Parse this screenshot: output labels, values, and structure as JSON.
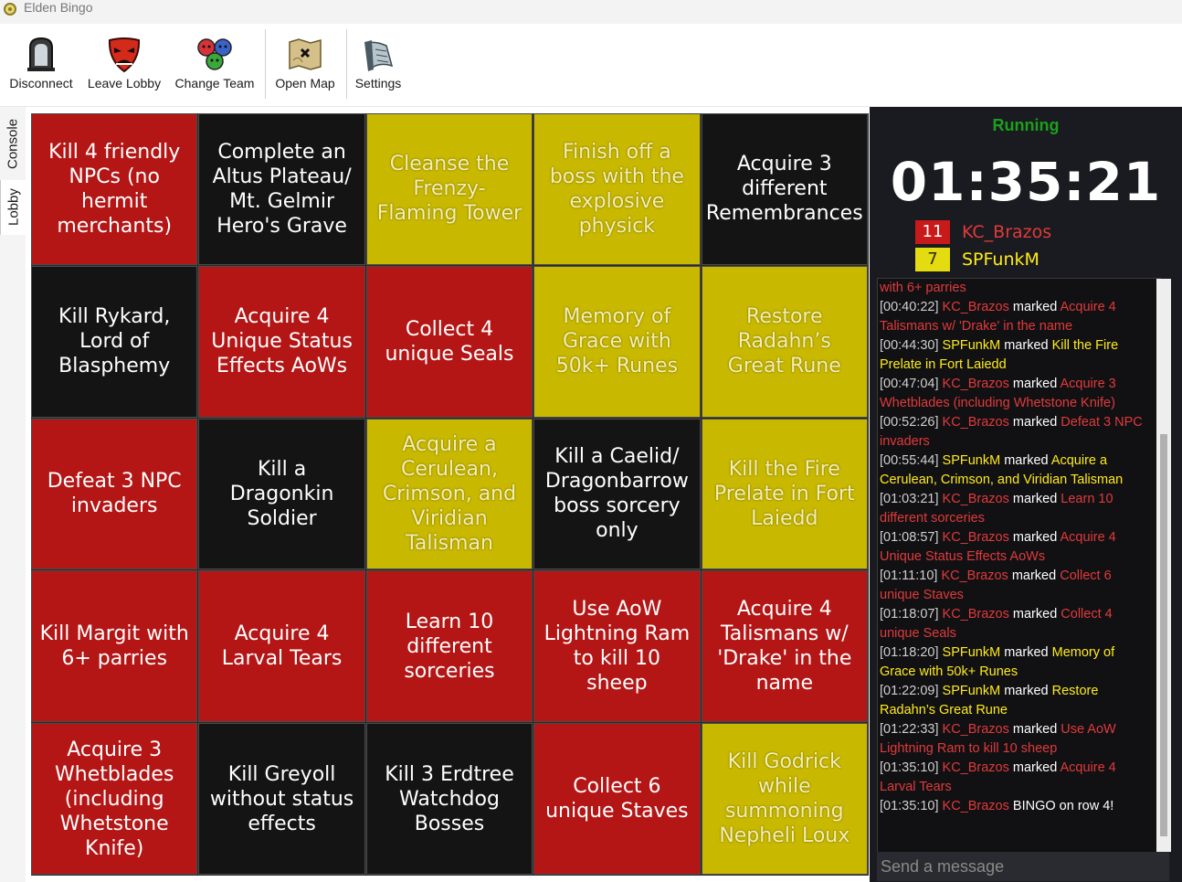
{
  "window": {
    "title": "Elden Bingo"
  },
  "toolbar": {
    "disconnect": "Disconnect",
    "leave_lobby": "Leave Lobby",
    "change_team": "Change Team",
    "open_map": "Open Map",
    "settings": "Settings"
  },
  "sidetabs": {
    "console": "Console",
    "lobby": "Lobby"
  },
  "board": {
    "cells": [
      {
        "text": "Kill 4 friendly NPCs (no hermit merchants)",
        "color": "red"
      },
      {
        "text": "Complete an Altus Plateau/ Mt. Gelmir Hero's Grave",
        "color": "black"
      },
      {
        "text": "Cleanse the Frenzy-Flaming Tower",
        "color": "yellow"
      },
      {
        "text": "Finish off a boss with the explosive physick",
        "color": "yellow"
      },
      {
        "text": "Acquire 3 different Remembrances",
        "color": "black"
      },
      {
        "text": "Kill Rykard, Lord of Blasphemy",
        "color": "black"
      },
      {
        "text": "Acquire 4 Unique Status Effects AoWs",
        "color": "red"
      },
      {
        "text": "Collect 4 unique Seals",
        "color": "red"
      },
      {
        "text": "Memory of Grace with 50k+ Runes",
        "color": "yellow"
      },
      {
        "text": "Restore Radahn’s Great Rune",
        "color": "yellow"
      },
      {
        "text": "Defeat 3 NPC invaders",
        "color": "red"
      },
      {
        "text": "Kill a Dragonkin Soldier",
        "color": "black"
      },
      {
        "text": "Acquire a Cerulean, Crimson, and Viridian Talisman",
        "color": "yellow"
      },
      {
        "text": "Kill a Caelid/ Dragonbarrow boss sorcery only",
        "color": "black"
      },
      {
        "text": "Kill the Fire Prelate in Fort Laiedd",
        "color": "yellow"
      },
      {
        "text": "Kill Margit with 6+ parries",
        "color": "red"
      },
      {
        "text": "Acquire 4 Larval Tears",
        "color": "red"
      },
      {
        "text": "Learn 10 different sorceries",
        "color": "red"
      },
      {
        "text": "Use AoW Lightning Ram to kill 10 sheep",
        "color": "red"
      },
      {
        "text": "Acquire 4 Talismans w/ 'Drake' in the name",
        "color": "red"
      },
      {
        "text": "Acquire 3 Whetblades (including Whetstone Knife)",
        "color": "red"
      },
      {
        "text": "Kill Greyoll without status effects",
        "color": "black"
      },
      {
        "text": "Kill 3 Erdtree Watchdog Bosses",
        "color": "black"
      },
      {
        "text": "Collect 6 unique Staves",
        "color": "red"
      },
      {
        "text": "Kill Godrick while summoning Nepheli Loux",
        "color": "yellow"
      }
    ]
  },
  "game": {
    "status": "Running",
    "timer": "01:35:21",
    "teams": [
      {
        "score": "11",
        "name": "KC_Brazos",
        "color": "#c81a1a",
        "text_color": "#e03a3a",
        "score_text": "#ffffff"
      },
      {
        "score": "7",
        "name": "SPFunkM",
        "color": "#e4dc10",
        "text_color": "#ffeb1a",
        "score_text": "#2a2a00"
      }
    ]
  },
  "chat": {
    "lines": [
      [
        {
          "c": "r",
          "t": "with 6+ parries"
        }
      ],
      [
        {
          "c": "t",
          "t": "[00:40:22] "
        },
        {
          "c": "r",
          "t": "KC_Brazos"
        },
        {
          "c": "w",
          "t": " marked "
        },
        {
          "c": "r",
          "t": "Acquire 4 Talismans w/ 'Drake' in the name"
        }
      ],
      [
        {
          "c": "t",
          "t": "[00:44:30] "
        },
        {
          "c": "y",
          "t": "SPFunkM"
        },
        {
          "c": "w",
          "t": " marked "
        },
        {
          "c": "y",
          "t": "Kill the Fire Prelate in Fort Laiedd"
        }
      ],
      [
        {
          "c": "t",
          "t": "[00:47:04] "
        },
        {
          "c": "r",
          "t": "KC_Brazos"
        },
        {
          "c": "w",
          "t": " marked "
        },
        {
          "c": "r",
          "t": "Acquire 3 Whetblades (including Whetstone Knife)"
        }
      ],
      [
        {
          "c": "t",
          "t": "[00:52:26] "
        },
        {
          "c": "r",
          "t": "KC_Brazos"
        },
        {
          "c": "w",
          "t": " marked "
        },
        {
          "c": "r",
          "t": "Defeat 3 NPC invaders"
        }
      ],
      [
        {
          "c": "t",
          "t": "[00:55:44] "
        },
        {
          "c": "y",
          "t": "SPFunkM"
        },
        {
          "c": "w",
          "t": " marked "
        },
        {
          "c": "y",
          "t": "Acquire a Cerulean, Crimson, and Viridian Talisman"
        }
      ],
      [
        {
          "c": "t",
          "t": "[01:03:21] "
        },
        {
          "c": "r",
          "t": "KC_Brazos"
        },
        {
          "c": "w",
          "t": " marked "
        },
        {
          "c": "r",
          "t": "Learn 10 different sorceries"
        }
      ],
      [
        {
          "c": "t",
          "t": "[01:08:57] "
        },
        {
          "c": "r",
          "t": "KC_Brazos"
        },
        {
          "c": "w",
          "t": " marked "
        },
        {
          "c": "r",
          "t": "Acquire 4 Unique Status Effects AoWs"
        }
      ],
      [
        {
          "c": "t",
          "t": "[01:11:10] "
        },
        {
          "c": "r",
          "t": "KC_Brazos"
        },
        {
          "c": "w",
          "t": " marked "
        },
        {
          "c": "r",
          "t": "Collect 6 unique Staves"
        }
      ],
      [
        {
          "c": "t",
          "t": "[01:18:07] "
        },
        {
          "c": "r",
          "t": "KC_Brazos"
        },
        {
          "c": "w",
          "t": " marked "
        },
        {
          "c": "r",
          "t": "Collect 4 unique Seals"
        }
      ],
      [
        {
          "c": "t",
          "t": "[01:18:20] "
        },
        {
          "c": "y",
          "t": "SPFunkM"
        },
        {
          "c": "w",
          "t": " marked "
        },
        {
          "c": "y",
          "t": "Memory of Grace with 50k+ Runes"
        }
      ],
      [
        {
          "c": "t",
          "t": "[01:22:09] "
        },
        {
          "c": "y",
          "t": "SPFunkM"
        },
        {
          "c": "w",
          "t": " marked "
        },
        {
          "c": "y",
          "t": "Restore Radahn’s Great Rune"
        }
      ],
      [
        {
          "c": "t",
          "t": "[01:22:33] "
        },
        {
          "c": "r",
          "t": "KC_Brazos"
        },
        {
          "c": "w",
          "t": " marked "
        },
        {
          "c": "r",
          "t": "Use AoW Lightning Ram to kill 10 sheep"
        }
      ],
      [
        {
          "c": "t",
          "t": "[01:35:10] "
        },
        {
          "c": "r",
          "t": "KC_Brazos"
        },
        {
          "c": "w",
          "t": " marked "
        },
        {
          "c": "r",
          "t": "Acquire 4 Larval Tears"
        }
      ],
      [
        {
          "c": "t",
          "t": "[01:35:10] "
        },
        {
          "c": "r",
          "t": "KC_Brazos"
        },
        {
          "c": "w",
          "t": " BINGO on row 4!"
        }
      ]
    ],
    "placeholder": "Send a message"
  }
}
